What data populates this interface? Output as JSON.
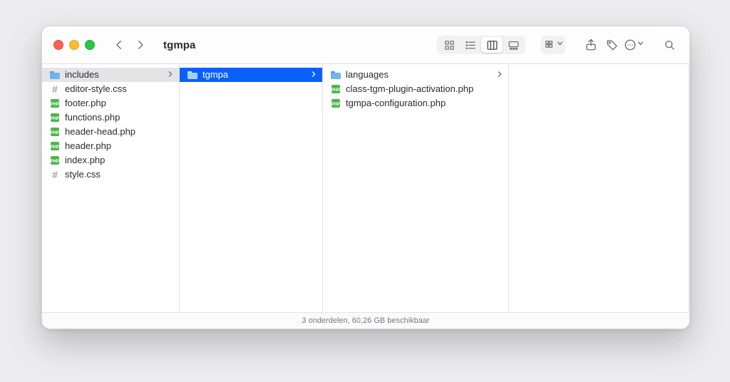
{
  "toolbar": {
    "title": "tgmpa",
    "view_mode": "columns"
  },
  "columns": [
    {
      "selected_index": 0,
      "items": [
        {
          "name": "includes",
          "type": "folder"
        },
        {
          "name": "editor-style.css",
          "type": "css"
        },
        {
          "name": "footer.php",
          "type": "php"
        },
        {
          "name": "functions.php",
          "type": "php"
        },
        {
          "name": "header-head.php",
          "type": "php"
        },
        {
          "name": "header.php",
          "type": "php"
        },
        {
          "name": "index.php",
          "type": "php"
        },
        {
          "name": "style.css",
          "type": "css"
        }
      ]
    },
    {
      "selected_index": 0,
      "items": [
        {
          "name": "tgmpa",
          "type": "folder"
        }
      ]
    },
    {
      "selected_index": null,
      "items": [
        {
          "name": "languages",
          "type": "folder"
        },
        {
          "name": "class-tgm-plugin-activation.php",
          "type": "php"
        },
        {
          "name": "tgmpa-configuration.php",
          "type": "php"
        }
      ]
    }
  ],
  "status": {
    "text": "3 onderdelen, 60,26 GB beschikbaar",
    "item_count": 3,
    "free_space_gb": 60.26
  },
  "colors": {
    "selection_blue": "#0a60ff",
    "selection_grey": "#e4e4e6",
    "folder_fill": "#6fb5ec",
    "php_fill": "#4cb648"
  }
}
